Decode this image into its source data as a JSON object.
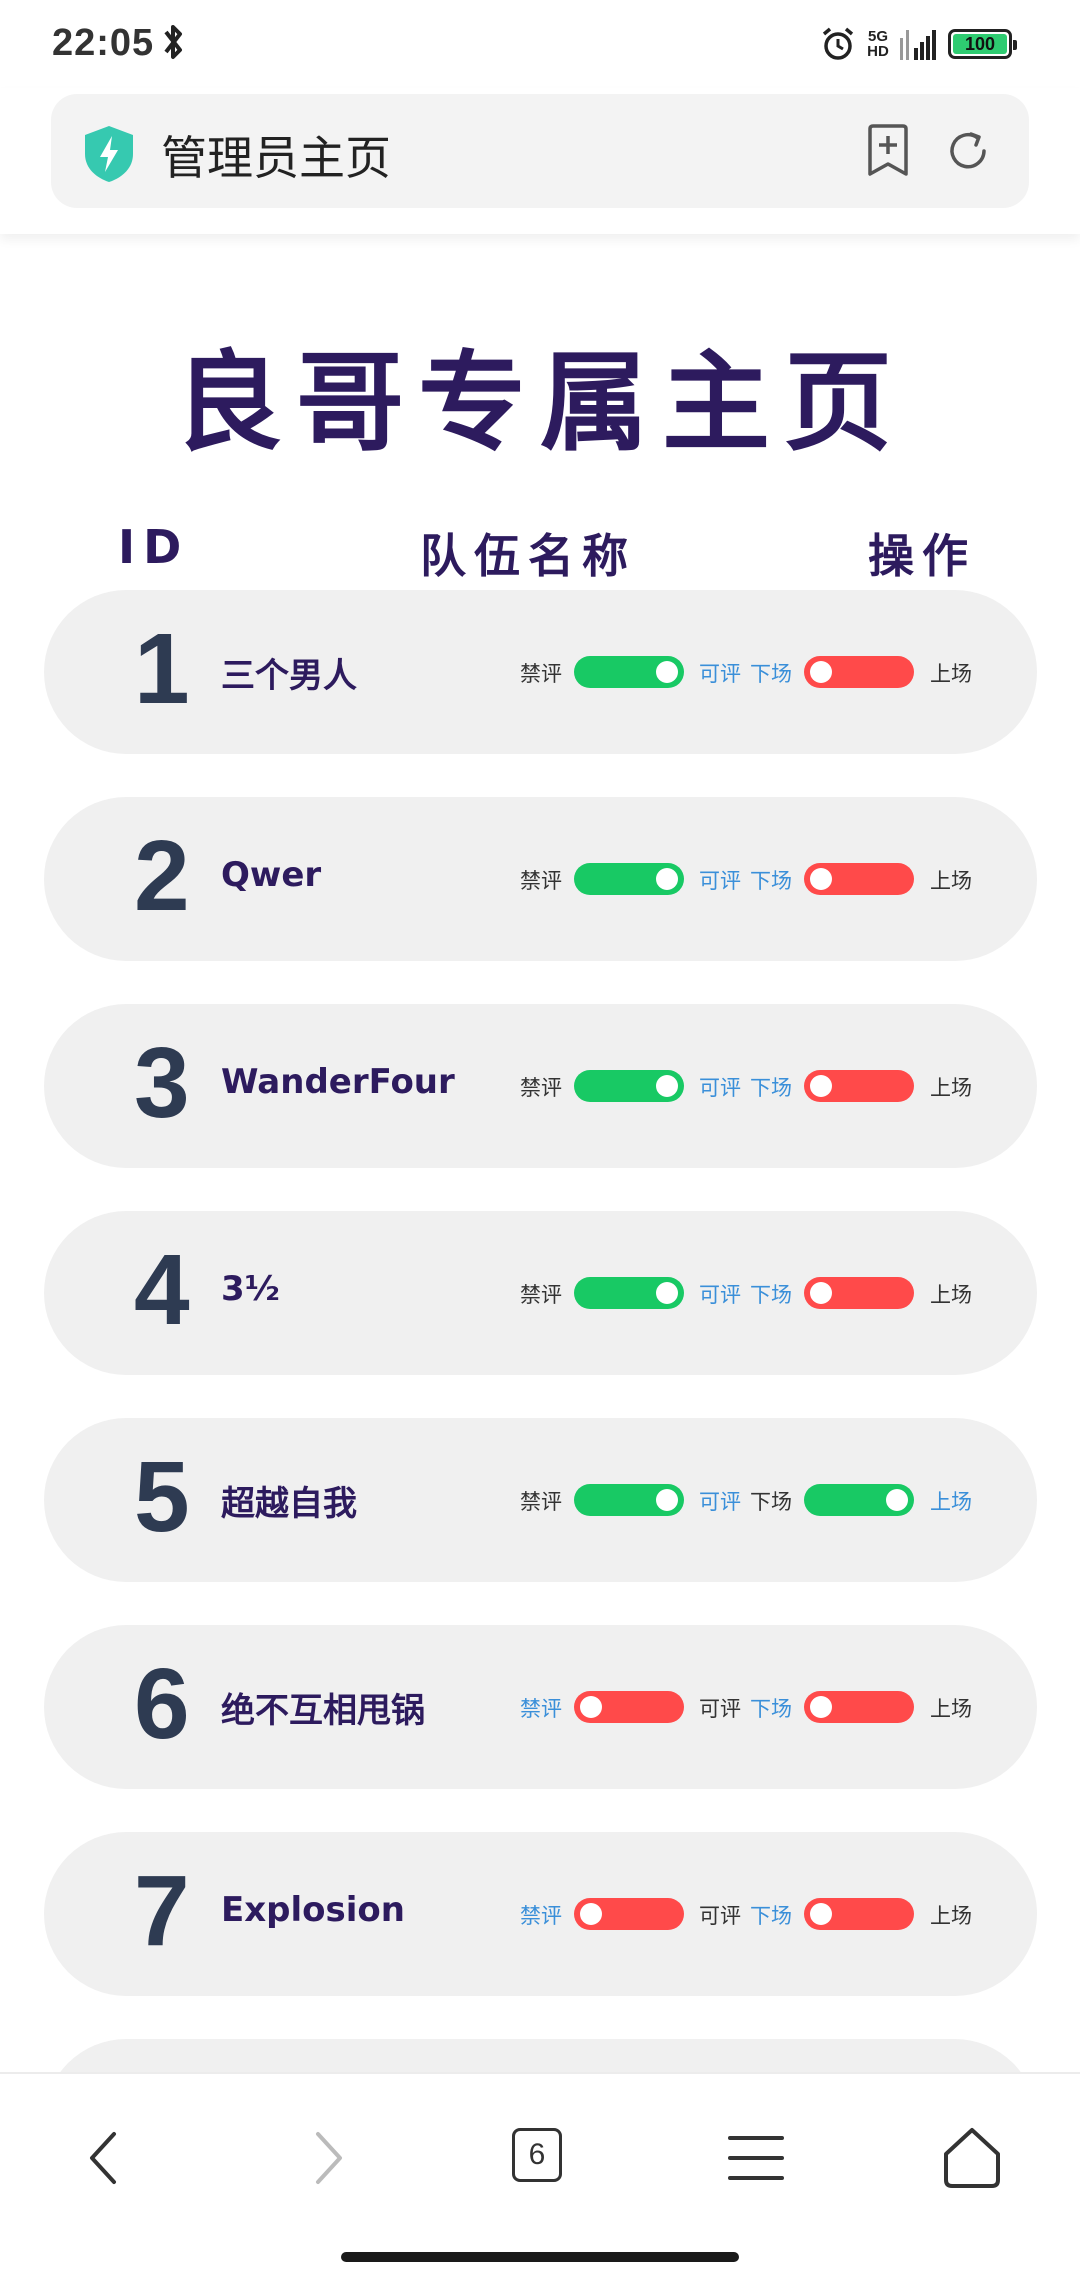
{
  "status_bar": {
    "time": "22:05",
    "network": "5G HD",
    "battery": "100"
  },
  "browser": {
    "page_title": "管理员主页",
    "tab_count": "6"
  },
  "page": {
    "heading": "良哥专属主页",
    "columns": {
      "id": "ID",
      "name": "队伍名称",
      "action": "操作"
    },
    "labels": {
      "ban": "禁评",
      "allow": "可评",
      "off": "下场",
      "on": "上场"
    },
    "rows": [
      {
        "id": "1",
        "name": "三个男人",
        "review_allowed": true,
        "on_stage": false
      },
      {
        "id": "2",
        "name": "Qwer",
        "review_allowed": true,
        "on_stage": false
      },
      {
        "id": "3",
        "name": "WanderFour",
        "review_allowed": true,
        "on_stage": false
      },
      {
        "id": "4",
        "name": "3½",
        "review_allowed": true,
        "on_stage": false
      },
      {
        "id": "5",
        "name": "超越自我",
        "review_allowed": true,
        "on_stage": true
      },
      {
        "id": "6",
        "name": "绝不互相甩锅",
        "review_allowed": false,
        "on_stage": false
      },
      {
        "id": "7",
        "name": "Explosion",
        "review_allowed": false,
        "on_stage": false
      }
    ]
  },
  "colors": {
    "heading": "#2d1b5e",
    "toggle_on": "#18c964",
    "toggle_off": "#ff4a4a",
    "active_label": "#3a8fd9",
    "row_bg": "#f0f0f0"
  }
}
